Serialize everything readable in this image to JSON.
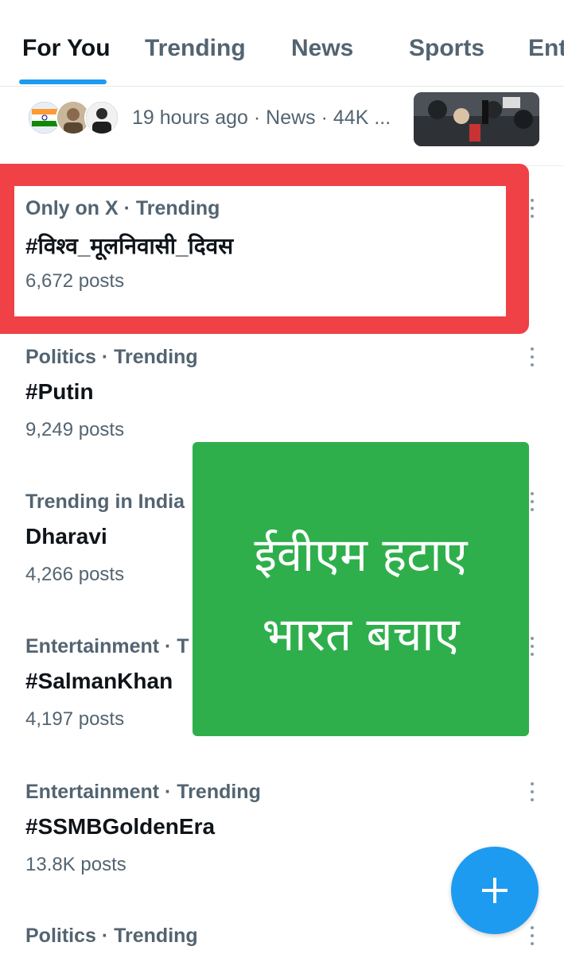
{
  "tabs": [
    {
      "label": "For You",
      "active": true
    },
    {
      "label": "Trending",
      "active": false
    },
    {
      "label": "News",
      "active": false
    },
    {
      "label": "Sports",
      "active": false
    },
    {
      "label": "Ent",
      "active": false
    }
  ],
  "news": {
    "meta": "19 hours ago · News · 44K ..."
  },
  "trends": [
    {
      "meta": "Only on X · Trending",
      "title": "#विश्व_मूलनिवासी_दिवस",
      "count": "6,672 posts"
    },
    {
      "meta": "Politics · Trending",
      "title": "#Putin",
      "count": "9,249 posts"
    },
    {
      "meta": "Trending in India",
      "title": "Dharavi",
      "count": "4,266 posts"
    },
    {
      "meta": "Entertainment · T",
      "title": "#SalmanKhan",
      "count": "4,197 posts"
    },
    {
      "meta": "Entertainment · Trending",
      "title": "#SSMBGoldenEra",
      "count": "13.8K posts"
    },
    {
      "meta": "Politics · Trending",
      "title": "",
      "count": ""
    }
  ],
  "overlay": {
    "line1": "ईवीएम हटाए",
    "line2": "भारत बचाए"
  },
  "colors": {
    "accent": "#1d9bf0",
    "highlight": "#ef4146",
    "overlay": "#2faf4c"
  },
  "icons": {
    "more": "more-vertical-icon",
    "compose": "plus-icon"
  }
}
